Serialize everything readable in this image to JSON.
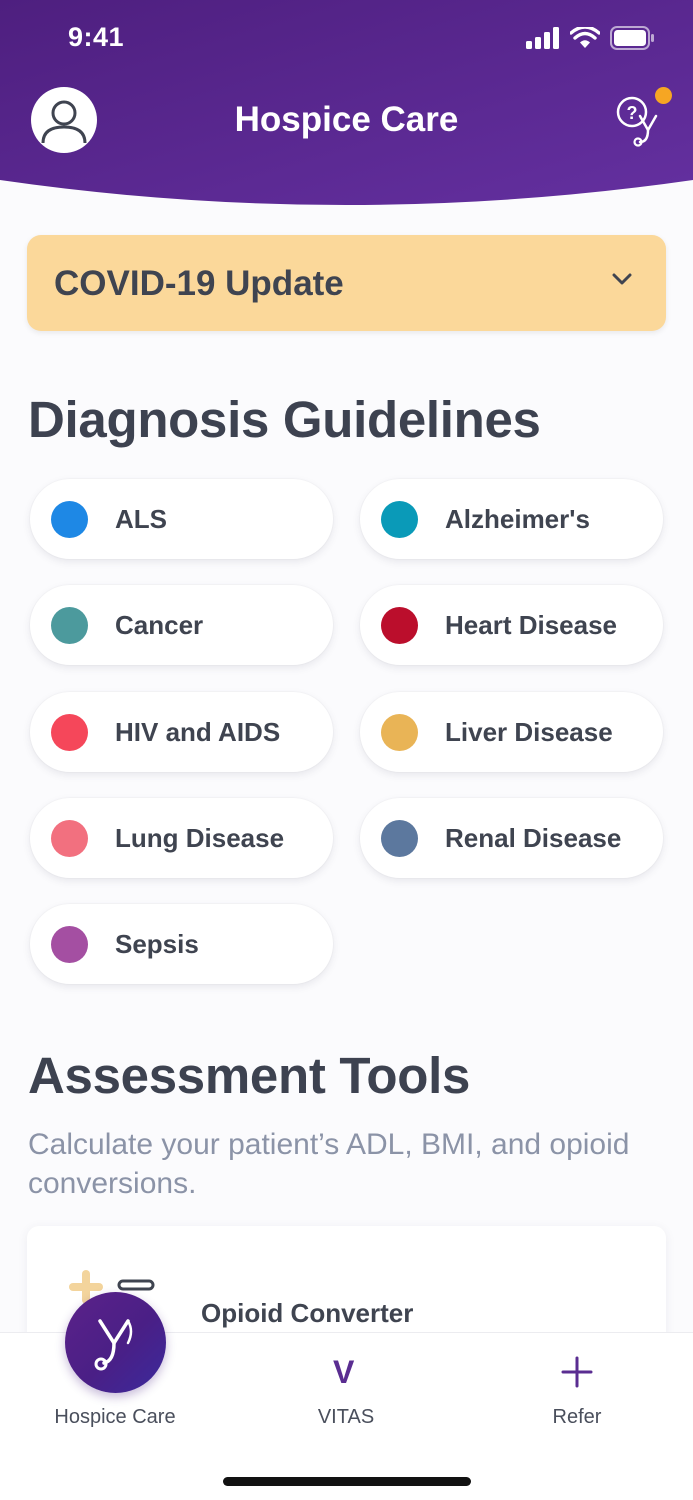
{
  "status_bar": {
    "time": "9:41"
  },
  "header": {
    "title": "Hospice Care",
    "colors": {
      "bg_start": "#4e1f7f",
      "bg_end": "#6430a0",
      "notification": "#f6a623"
    }
  },
  "covid_banner": {
    "label": "COVID-19 Update",
    "color": "#fbd89a"
  },
  "diagnosis": {
    "heading": "Diagnosis Guidelines",
    "items": [
      {
        "label": "ALS",
        "color": "#1e88e5"
      },
      {
        "label": "Alzheimer's",
        "color": "#0a9ab8"
      },
      {
        "label": "Cancer",
        "color": "#4c9a9d"
      },
      {
        "label": "Heart Disease",
        "color": "#bb0e2c"
      },
      {
        "label": "HIV and AIDS",
        "color": "#f5475a"
      },
      {
        "label": "Liver Disease",
        "color": "#e9b456"
      },
      {
        "label": "Lung Disease",
        "color": "#f2707f"
      },
      {
        "label": "Renal Disease",
        "color": "#5c789e"
      },
      {
        "label": "Sepsis",
        "color": "#a44fa2"
      }
    ]
  },
  "assessment": {
    "heading": "Assessment Tools",
    "subtitle": "Calculate your patient’s ADL, BMI, and opioid conversions.",
    "tools": [
      {
        "label": "Opioid Converter",
        "icon": "plus-minus-icon"
      }
    ]
  },
  "tabbar": {
    "items": [
      {
        "label": "Hospice Care",
        "icon": "stethoscope-icon",
        "active": true
      },
      {
        "label": "VITAS",
        "glyph": "V",
        "icon": "vitas-logo-icon"
      },
      {
        "label": "Refer",
        "icon": "plus-icon"
      }
    ]
  }
}
